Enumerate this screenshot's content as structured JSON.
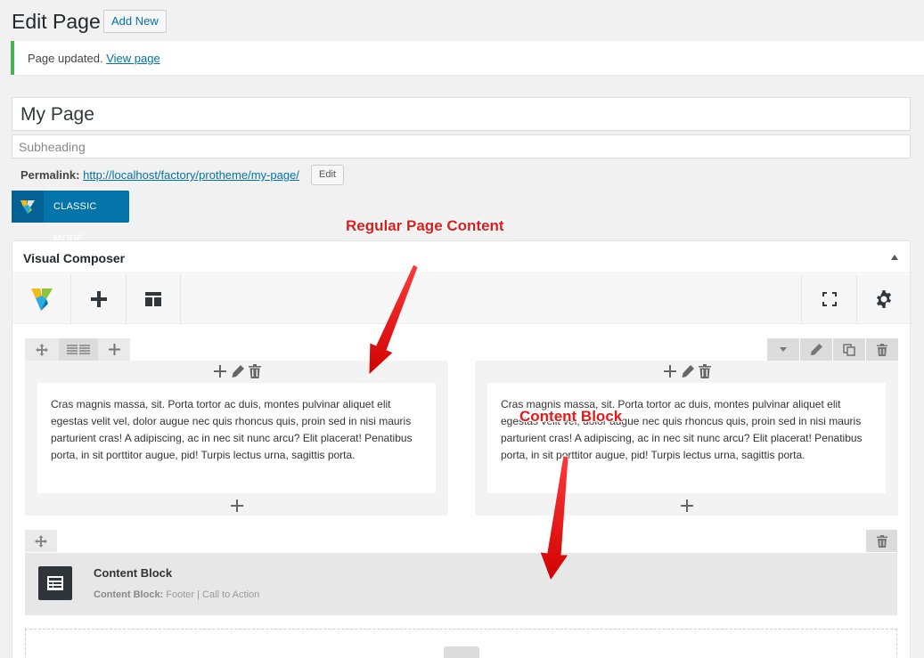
{
  "header": {
    "title": "Edit Page",
    "add_new_label": "Add New"
  },
  "notice": {
    "text": "Page updated.",
    "link_label": "View page"
  },
  "editor": {
    "title_value": "My Page",
    "subheading_placeholder": "Subheading",
    "permalink_label": "Permalink:",
    "permalink_url_base": "http://localhost/factory/protheme/",
    "permalink_slug": "my-page",
    "permalink_url_end": "/",
    "permalink_edit_label": "Edit",
    "classic_mode_label": "CLASSIC MODE"
  },
  "vc": {
    "title": "Visual Composer",
    "column_text": "Cras magnis massa, sit. Porta tortor ac duis, montes pulvinar aliquet elit egestas velit vel, dolor augue nec quis rhoncus quis, proin sed in nisi mauris parturient cras! A adipiscing, ac in nec sit nunc arcu? Elit placerat! Penatibus porta, in sit porttitor augue, pid! Turpis lectus urna, sagittis porta.",
    "content_block": {
      "title": "Content Block",
      "meta_label": "Content Block:",
      "meta_value": "Footer | Call to Action"
    }
  },
  "annotations": {
    "regular": "Regular Page Content",
    "content_block": "Content Block"
  },
  "colors": {
    "accent": "#0073aa",
    "notice_success": "#46b450",
    "annotation": "#e21a1a"
  },
  "icons": [
    "move-icon",
    "row-layout-icon",
    "plus-icon",
    "pencil-icon",
    "trash-icon",
    "clone-icon",
    "chevron-down-icon",
    "vc-logo-icon",
    "template-icon",
    "fullscreen-icon",
    "gear-icon",
    "content-block-icon"
  ]
}
